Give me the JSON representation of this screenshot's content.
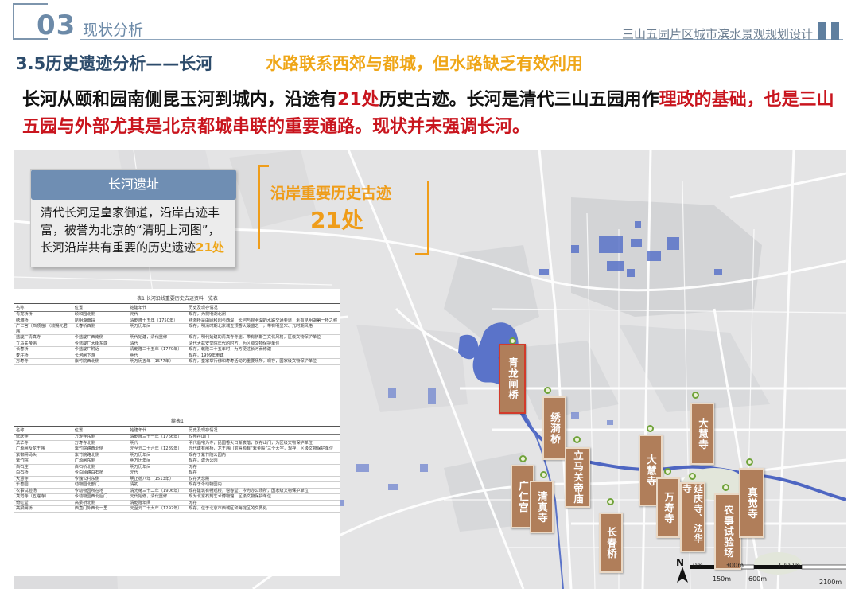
{
  "header": {
    "section_number": "03",
    "section_title": "现状分析",
    "project_title": "三山五园片区城市滨水景观规划设计"
  },
  "section": {
    "title": "3.5历史遗迹分析——长河",
    "subtitle": "水路联系西郊与都城，但水路缺乏有效利用"
  },
  "intro": {
    "part1": "长河从颐和园南侧昆玉河到城内，沿途有",
    "count": "21处",
    "part2": "历史古迹。长河是清代三山五园用作",
    "emph1": "理政的基础，也是三山五园与外部尤其是北京都城串联的重要通路。现状并未强调长河。"
  },
  "card": {
    "title": "长河遗址",
    "body": "清代长河是皇家御道，沿岸古迹丰富，被誉为北京的“清明上河图”，长河沿岸共有重要的历史遗迹",
    "count": "21处"
  },
  "callout": {
    "label": "沿岸重要历史古迹",
    "count": "21处"
  },
  "table1": {
    "caption": "表1 长河沿线重要历史古迹资料一览表",
    "headers": [
      "名称",
      "位置",
      "始建年代",
      "历史及现存情况"
    ],
    "rows": [
      [
        "青龙桥桥",
        "颐和园北侧",
        "元代",
        "现存，为昆明湖北闸"
      ],
      [
        "绣漪桥",
        "昆明湖南段",
        "清乾隆十五年（1750年）",
        "绣漪桥是由颐和园与西堤，长河与昆明湖的水路交通要道，素有昆明湖第一桥之称"
      ],
      [
        "广仁宫（西顶庙）（敕赐元君庙）",
        "长春桥西侧",
        "明万历年间",
        "现存，明清时期北京城五顶香火最盛之一，带有明显宋、元时期风格"
      ],
      [
        "蓝靛厂清真寺",
        "今蓝靛厂西南侧",
        "明代始建，清代重修",
        "现存，明代始建的清真寺寺庙，带有伊斯兰文化风格，区级文物保护单位"
      ],
      [
        "立马关帝庙",
        "今蓝靛厂大街东端",
        "清代",
        "清代大兹安堂院年代的时方，为区级文物保护单位"
      ],
      [
        "长春桥",
        "今蓝靛厂附近",
        "清乾隆三十五年（1770年）",
        "现存，乾隆三十五年时，为方便过长河而修建"
      ],
      [
        "麦庄桥",
        "长河闸下游",
        "明代",
        "现存，1999年重建"
      ],
      [
        "万寿寺",
        "紫竹院西北侧",
        "明万历五年（1577年）",
        "现存，皇家举行佛和寿寿活动的重要场所，现存，国家级文物保护单位"
      ]
    ]
  },
  "table2": {
    "caption": "续表1",
    "headers": [
      "名称",
      "位置",
      "始建年代",
      "历史及现存情况"
    ],
    "rows": [
      [
        "延庆寺",
        "万寿寺东侧",
        "清乾隆三十一年（1766年）",
        "仅残存山门"
      ],
      [
        "法华寺",
        "万寿寺北侧",
        "明代",
        "明代倡宅为寺，民国香火日渐衰落，仅存山门，为区级文物保护单位"
      ],
      [
        "广源闸及龙王庙",
        "紫竹院路西北侧",
        "元至元二十六年（1289年）",
        "元代建有闸桥，龙王庙门前匾额有“紫金殿”三个大字，现存，区级文物保护单位"
      ],
      [
        "紫御闸码头",
        "紫竹院路北侧",
        "明万历年间",
        "现存于紫竹院公园内"
      ],
      [
        "紫竹院",
        "广源闸东侧",
        "明万历年间",
        "现存，建为公园"
      ],
      [
        "白石庄",
        "白石桥北侧",
        "明万历年间",
        "无存"
      ],
      [
        "白石桥",
        "今白颐路白石桥",
        "元代",
        "现存"
      ],
      [
        "大慧寺",
        "今魏公村东侧",
        "明正德八年（1513年）",
        "仅存大悲殿"
      ],
      [
        "乐善园",
        "动物园北部门",
        "清初",
        "现存于今动物园内"
      ],
      [
        "农事试验场",
        "今动物园所在地",
        "清光绪三十二年（1906年）",
        "现存建筑有畅观楼，鬯春堂，今为办公场所，国家级文物保护单位"
      ],
      [
        "真觉寺（五塔寺）",
        "今动物园西北后门",
        "元代始修，清代重修",
        "现为北京石刻艺术博物馆，区级文物保护单位"
      ],
      [
        "倚虹堂",
        "高梁桥北侧",
        "清乾隆年间",
        "无存"
      ],
      [
        "高梁闸桥",
        "西直门外西北一里",
        "元至元二十九年（1292年）",
        "现存，位于北京市西城区和海淀区的交界处"
      ]
    ]
  },
  "sites": [
    {
      "name": "青龙闸桥",
      "border": "red"
    },
    {
      "name": "绣漪桥",
      "border": "normal"
    },
    {
      "name": "立马关帝庙",
      "border": "normal"
    },
    {
      "name": "广仁宫",
      "border": "normal"
    },
    {
      "name": "清真寺",
      "border": "normal"
    },
    {
      "name": "长春桥",
      "border": "normal"
    },
    {
      "name": "大慧寺",
      "border": "normal"
    },
    {
      "name": "大慧寺",
      "border": "normal"
    },
    {
      "name": "万寿寺",
      "border": "normal"
    },
    {
      "name": "延庆寺、法华寺",
      "border": "normal"
    },
    {
      "name": "农事试验场",
      "border": "normal"
    },
    {
      "name": "真觉寺",
      "border": "normal"
    }
  ],
  "map": {
    "compass": "N",
    "scale": [
      "0m",
      "300m",
      "150m",
      "600m",
      "1200m",
      "2100m"
    ],
    "colors": {
      "water": "#5a73c9",
      "road": "#ffffff",
      "land": "#e3e3e4",
      "river_highlight": "#4e66c2"
    }
  }
}
